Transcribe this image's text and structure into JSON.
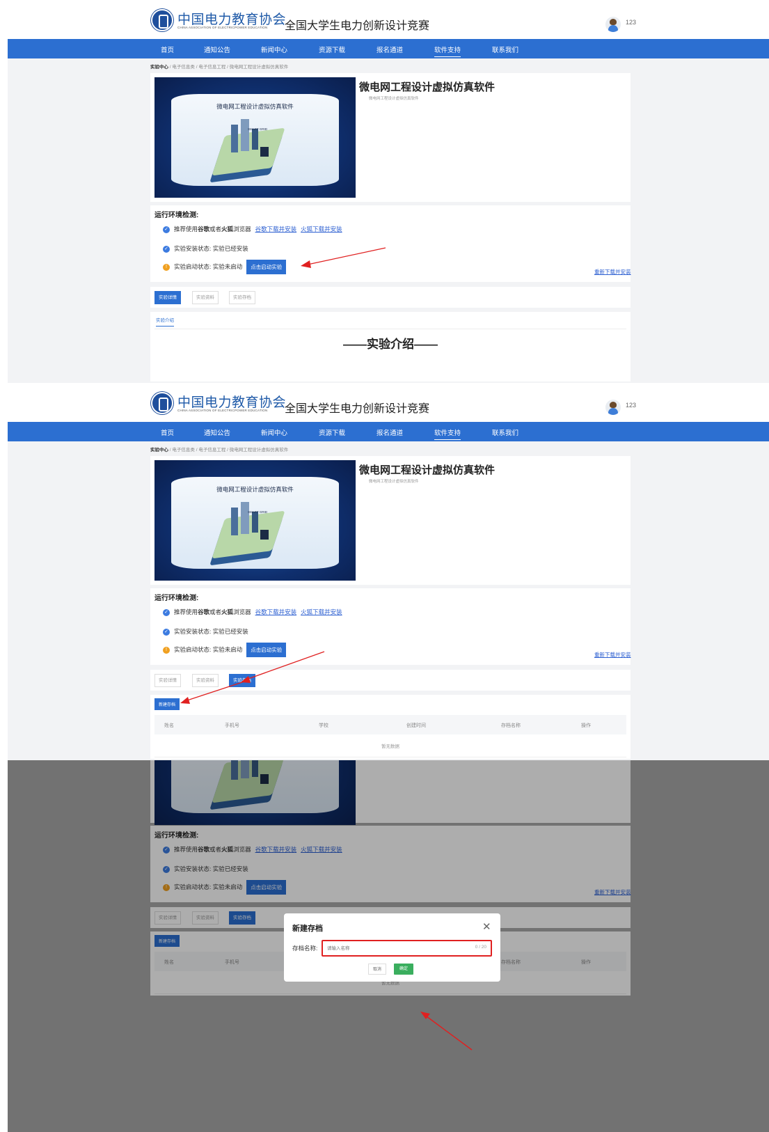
{
  "header": {
    "logo_cn": "中国电力教育协会",
    "logo_en": "CHINA ASSOCIATION OF ELECTRICPOWER EDUCATION",
    "site_title": "全国大学生电力创新设计竞赛",
    "username": "123"
  },
  "nav": {
    "items": [
      "首页",
      "通知公告",
      "新闻中心",
      "资源下载",
      "报名通道",
      "软件支持",
      "联系我们"
    ],
    "active": "软件支持"
  },
  "breadcrumb": {
    "root": "实验中心",
    "path": " / 电子信息类 / 电子信息工程 / 微电网工程设计虚拟仿真软件"
  },
  "software": {
    "image_title": "微电网工程设计虚拟仿真软件",
    "image_label": "SMART GRID",
    "title": "微电网工程设计虚拟仿真软件",
    "subtitle": "微电网工程设计虚拟仿真软件"
  },
  "env": {
    "title": "运行环境检测:",
    "browser_prefix": "推荐使用",
    "browser_chrome": "谷歌",
    "browser_or": "或者",
    "browser_firefox": "火狐",
    "browser_suffix": "浏览器",
    "chrome_link": "谷歌下载并安装",
    "firefox_link": "火狐下载并安装",
    "install_status": "实验安装状态: 实验已经安装",
    "start_status": "实验启动状态: 实验未启动",
    "start_button": "点击启动实验",
    "reinstall_link": "重新下载并安装"
  },
  "tabs": [
    "实验详情",
    "实验资料",
    "实验存档"
  ],
  "intro": {
    "tab": "实验介绍",
    "heading": "——实验介绍——"
  },
  "archive": {
    "new_button": "新建存档",
    "columns": [
      "姓名",
      "手机号",
      "学校",
      "创建时间",
      "存档名称",
      "操作"
    ],
    "empty_text": "暂无数据"
  },
  "dialog": {
    "title": "新建存档",
    "close_icon": "close-icon",
    "label": "存档名称:",
    "placeholder": "请输入名称",
    "counter": "0 / 20",
    "cancel": "取消",
    "confirm": "确定"
  },
  "colors": {
    "primary": "#2c6fd1",
    "confirm": "#3aae5e",
    "annotation": "#e02020"
  }
}
